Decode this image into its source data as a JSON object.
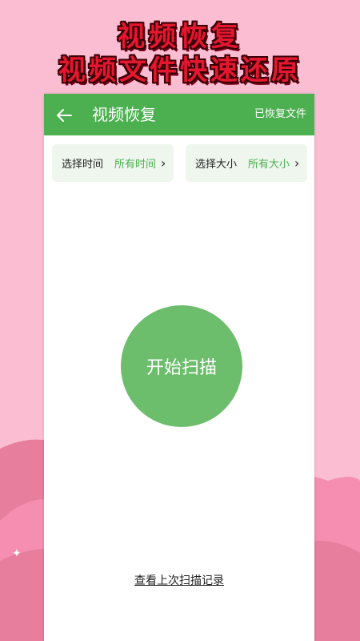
{
  "promo": {
    "headline_line1": "视频恢复",
    "headline_line2": "视频文件快速还原"
  },
  "app": {
    "title": "视频恢复",
    "action_label": "已恢复文件",
    "back_icon": "arrow-left-icon",
    "accent_color": "#4caf50",
    "filters": [
      {
        "label": "选择时间",
        "value": "所有时间"
      },
      {
        "label": "选择大小",
        "value": "所有大小"
      }
    ],
    "scan_button": "开始扫描",
    "history_link": "查看上次扫描记录"
  }
}
